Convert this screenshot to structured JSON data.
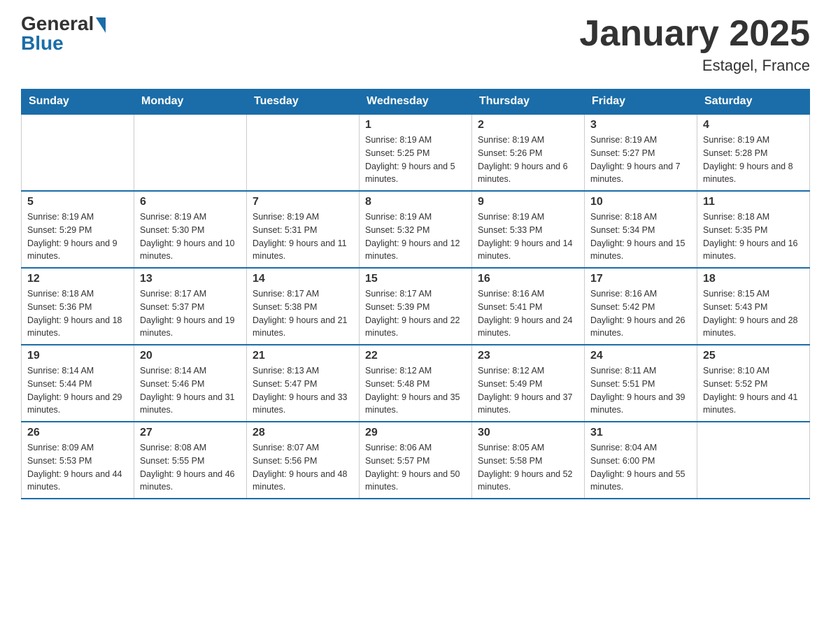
{
  "logo": {
    "general": "General",
    "blue": "Blue"
  },
  "title": "January 2025",
  "location": "Estagel, France",
  "days_of_week": [
    "Sunday",
    "Monday",
    "Tuesday",
    "Wednesday",
    "Thursday",
    "Friday",
    "Saturday"
  ],
  "weeks": [
    [
      {
        "day": "",
        "info": ""
      },
      {
        "day": "",
        "info": ""
      },
      {
        "day": "",
        "info": ""
      },
      {
        "day": "1",
        "info": "Sunrise: 8:19 AM\nSunset: 5:25 PM\nDaylight: 9 hours and 5 minutes."
      },
      {
        "day": "2",
        "info": "Sunrise: 8:19 AM\nSunset: 5:26 PM\nDaylight: 9 hours and 6 minutes."
      },
      {
        "day": "3",
        "info": "Sunrise: 8:19 AM\nSunset: 5:27 PM\nDaylight: 9 hours and 7 minutes."
      },
      {
        "day": "4",
        "info": "Sunrise: 8:19 AM\nSunset: 5:28 PM\nDaylight: 9 hours and 8 minutes."
      }
    ],
    [
      {
        "day": "5",
        "info": "Sunrise: 8:19 AM\nSunset: 5:29 PM\nDaylight: 9 hours and 9 minutes."
      },
      {
        "day": "6",
        "info": "Sunrise: 8:19 AM\nSunset: 5:30 PM\nDaylight: 9 hours and 10 minutes."
      },
      {
        "day": "7",
        "info": "Sunrise: 8:19 AM\nSunset: 5:31 PM\nDaylight: 9 hours and 11 minutes."
      },
      {
        "day": "8",
        "info": "Sunrise: 8:19 AM\nSunset: 5:32 PM\nDaylight: 9 hours and 12 minutes."
      },
      {
        "day": "9",
        "info": "Sunrise: 8:19 AM\nSunset: 5:33 PM\nDaylight: 9 hours and 14 minutes."
      },
      {
        "day": "10",
        "info": "Sunrise: 8:18 AM\nSunset: 5:34 PM\nDaylight: 9 hours and 15 minutes."
      },
      {
        "day": "11",
        "info": "Sunrise: 8:18 AM\nSunset: 5:35 PM\nDaylight: 9 hours and 16 minutes."
      }
    ],
    [
      {
        "day": "12",
        "info": "Sunrise: 8:18 AM\nSunset: 5:36 PM\nDaylight: 9 hours and 18 minutes."
      },
      {
        "day": "13",
        "info": "Sunrise: 8:17 AM\nSunset: 5:37 PM\nDaylight: 9 hours and 19 minutes."
      },
      {
        "day": "14",
        "info": "Sunrise: 8:17 AM\nSunset: 5:38 PM\nDaylight: 9 hours and 21 minutes."
      },
      {
        "day": "15",
        "info": "Sunrise: 8:17 AM\nSunset: 5:39 PM\nDaylight: 9 hours and 22 minutes."
      },
      {
        "day": "16",
        "info": "Sunrise: 8:16 AM\nSunset: 5:41 PM\nDaylight: 9 hours and 24 minutes."
      },
      {
        "day": "17",
        "info": "Sunrise: 8:16 AM\nSunset: 5:42 PM\nDaylight: 9 hours and 26 minutes."
      },
      {
        "day": "18",
        "info": "Sunrise: 8:15 AM\nSunset: 5:43 PM\nDaylight: 9 hours and 28 minutes."
      }
    ],
    [
      {
        "day": "19",
        "info": "Sunrise: 8:14 AM\nSunset: 5:44 PM\nDaylight: 9 hours and 29 minutes."
      },
      {
        "day": "20",
        "info": "Sunrise: 8:14 AM\nSunset: 5:46 PM\nDaylight: 9 hours and 31 minutes."
      },
      {
        "day": "21",
        "info": "Sunrise: 8:13 AM\nSunset: 5:47 PM\nDaylight: 9 hours and 33 minutes."
      },
      {
        "day": "22",
        "info": "Sunrise: 8:12 AM\nSunset: 5:48 PM\nDaylight: 9 hours and 35 minutes."
      },
      {
        "day": "23",
        "info": "Sunrise: 8:12 AM\nSunset: 5:49 PM\nDaylight: 9 hours and 37 minutes."
      },
      {
        "day": "24",
        "info": "Sunrise: 8:11 AM\nSunset: 5:51 PM\nDaylight: 9 hours and 39 minutes."
      },
      {
        "day": "25",
        "info": "Sunrise: 8:10 AM\nSunset: 5:52 PM\nDaylight: 9 hours and 41 minutes."
      }
    ],
    [
      {
        "day": "26",
        "info": "Sunrise: 8:09 AM\nSunset: 5:53 PM\nDaylight: 9 hours and 44 minutes."
      },
      {
        "day": "27",
        "info": "Sunrise: 8:08 AM\nSunset: 5:55 PM\nDaylight: 9 hours and 46 minutes."
      },
      {
        "day": "28",
        "info": "Sunrise: 8:07 AM\nSunset: 5:56 PM\nDaylight: 9 hours and 48 minutes."
      },
      {
        "day": "29",
        "info": "Sunrise: 8:06 AM\nSunset: 5:57 PM\nDaylight: 9 hours and 50 minutes."
      },
      {
        "day": "30",
        "info": "Sunrise: 8:05 AM\nSunset: 5:58 PM\nDaylight: 9 hours and 52 minutes."
      },
      {
        "day": "31",
        "info": "Sunrise: 8:04 AM\nSunset: 6:00 PM\nDaylight: 9 hours and 55 minutes."
      },
      {
        "day": "",
        "info": ""
      }
    ]
  ]
}
